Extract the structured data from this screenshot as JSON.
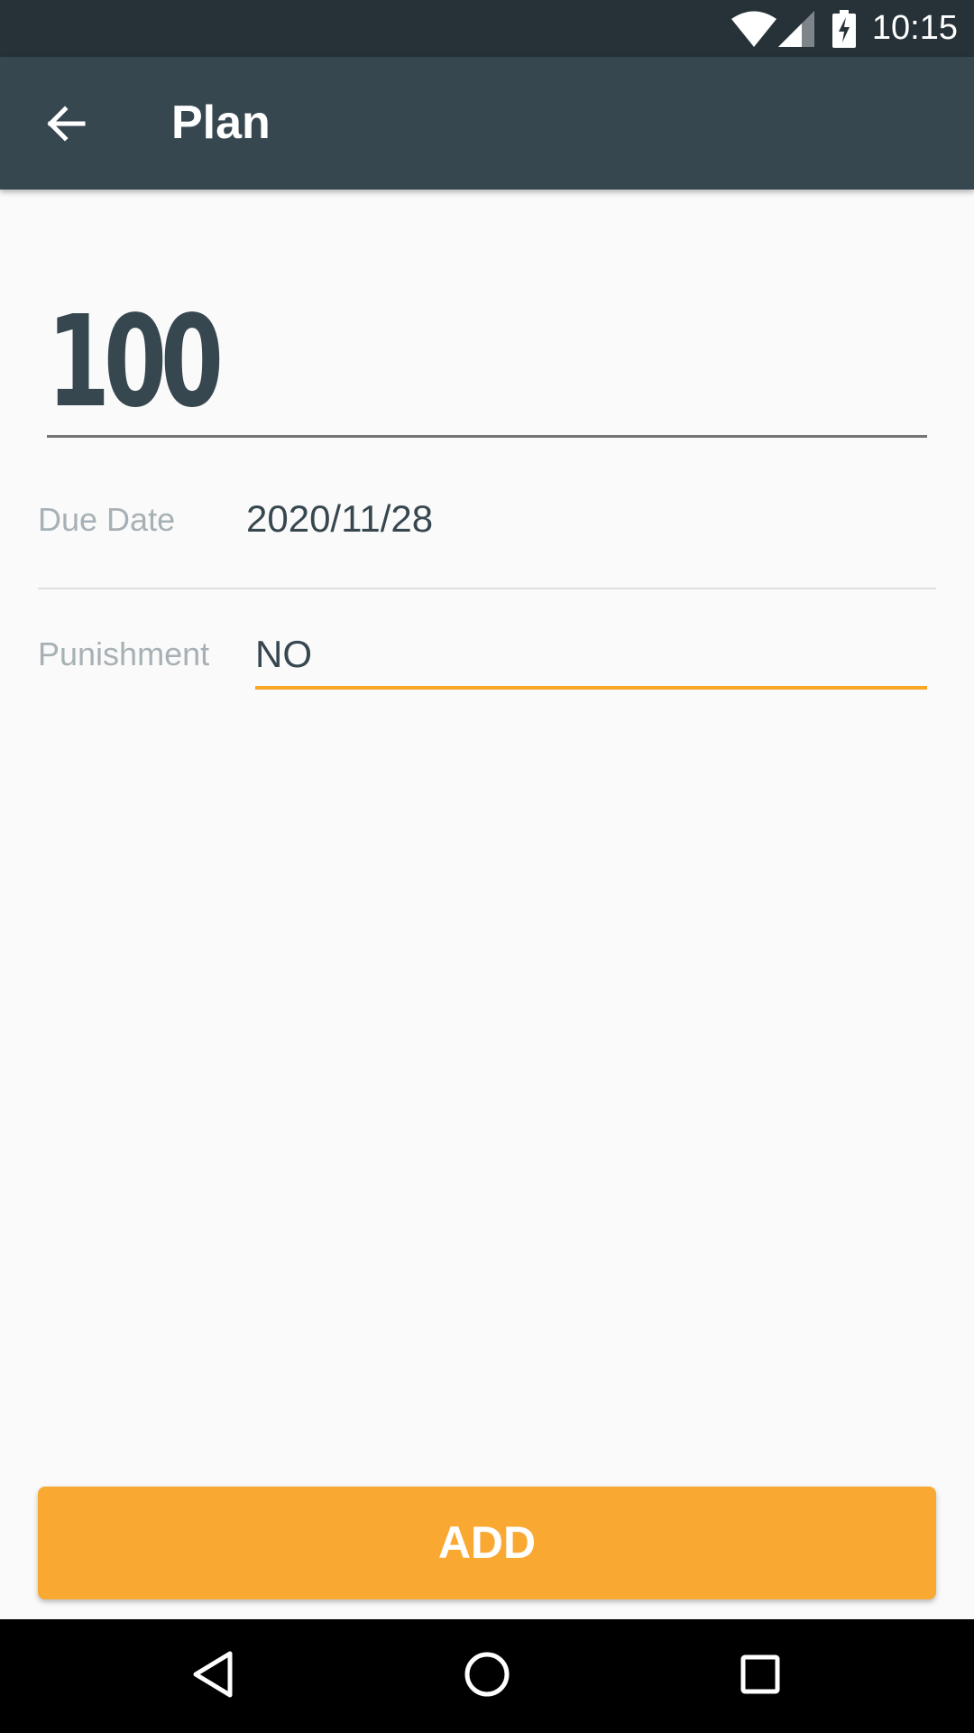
{
  "status_bar": {
    "time": "10:15",
    "icons": [
      "wifi-icon",
      "signal-icon",
      "battery-charging-icon"
    ]
  },
  "app_bar": {
    "title": "Plan",
    "back_icon": "arrow-back-icon"
  },
  "form": {
    "amount": "100",
    "due_date_label": "Due Date",
    "due_date_value": "2020/11/28",
    "punishment_label": "Punishment",
    "punishment_value": "NO"
  },
  "add_button": {
    "label": "ADD"
  },
  "nav_bar": {
    "icons": [
      "nav-back-icon",
      "nav-home-icon",
      "nav-recents-icon"
    ]
  },
  "colors": {
    "status_bar": "#263238",
    "app_bar": "#37474f",
    "accent": "#f9a825",
    "button": "#f9a932",
    "text_primary": "#37474f",
    "text_label": "#a7b0b5"
  }
}
